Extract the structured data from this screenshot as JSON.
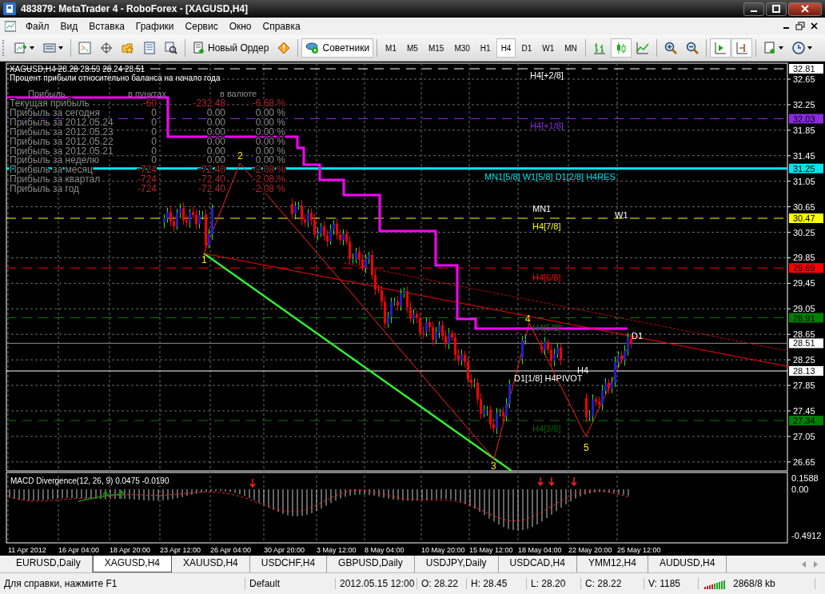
{
  "window": {
    "title": "483879: MetaTrader 4 - RoboForex - [XAGUSD,H4]"
  },
  "menu": [
    "Файл",
    "Вид",
    "Вставка",
    "Графики",
    "Сервис",
    "Окно",
    "Справка"
  ],
  "toolbar": {
    "new_order": "Новый Ордер",
    "expert_advisors": {
      "label": "Советники",
      "pressed": true
    },
    "timeframes": [
      {
        "label": "M1",
        "selected": false
      },
      {
        "label": "M5",
        "selected": false
      },
      {
        "label": "M15",
        "selected": false
      },
      {
        "label": "M30",
        "selected": false
      },
      {
        "label": "H1",
        "selected": false
      },
      {
        "label": "H4",
        "selected": true
      },
      {
        "label": "D1",
        "selected": false
      },
      {
        "label": "W1",
        "selected": false
      },
      {
        "label": "MN",
        "selected": false
      }
    ],
    "chart_types": [
      {
        "kind": "bars",
        "selected": false
      },
      {
        "kind": "candles",
        "selected": true
      },
      {
        "kind": "line",
        "selected": false
      }
    ],
    "auto_scroll": true,
    "chart_shift": true
  },
  "chart": {
    "header": "XAGUSD,H4 28.28 28.59 28.24 28.51",
    "subtitle": "Процент прибыли относительно баланса на начало года",
    "profit_table": {
      "columns": [
        "Прибыль",
        "в пунктах",
        "в валюте"
      ],
      "rows": [
        {
          "label": "Текущая прибыль",
          "points": "-60",
          "currency": "-232.48",
          "percent": "-6.68 %",
          "color": "#b02828"
        },
        {
          "label": "Прибыль за сегодня",
          "points": "0",
          "currency": "0.00",
          "percent": "0.00 %",
          "color": "#8c8c8c"
        },
        {
          "label": "Прибыль за 2012.05.24",
          "points": "0",
          "currency": "0.00",
          "percent": "0.00 %",
          "color": "#8c8c8c"
        },
        {
          "label": "Прибыль за 2012.05.23",
          "points": "0",
          "currency": "0.00",
          "percent": "0.00 %",
          "color": "#8c8c8c"
        },
        {
          "label": "Прибыль за 2012.05.22",
          "points": "0",
          "currency": "0.00",
          "percent": "0.00 %",
          "color": "#8c8c8c"
        },
        {
          "label": "Прибыль за 2012.05.21",
          "points": "0",
          "currency": "0.00",
          "percent": "0.00 %",
          "color": "#8c8c8c"
        },
        {
          "label": "Прибыль за неделю",
          "points": "0",
          "currency": "0.00",
          "percent": "0.00 %",
          "color": "#8c8c8c"
        },
        {
          "label": "Прибыль за месяц",
          "points": "-724",
          "currency": "-72.40",
          "percent": "-2.08 %",
          "color": "#b02828"
        },
        {
          "label": "Прибыль за квартал",
          "points": "-724",
          "currency": "-72.40",
          "percent": "-2.08 %",
          "color": "#b02828"
        },
        {
          "label": "Прибыль за год",
          "points": "-724",
          "currency": "-72.40",
          "percent": "-2.08 %",
          "color": "#b02828"
        }
      ]
    },
    "levels": [
      {
        "label": "H4[+2/8]",
        "color": "#ffffff"
      },
      {
        "label": "H4[+1/8]",
        "color": "#8a2be2"
      },
      {
        "label": "MN1[5/8] W1[5/8] D1[2/8] H4RES",
        "color": "#00e5ee"
      },
      {
        "label": "MN1",
        "color": "#ffffff"
      },
      {
        "label": "W1",
        "color": "#ffffff"
      },
      {
        "label": "H4[7/8]",
        "color": "#ffff00"
      },
      {
        "label": "H4[6/8]",
        "color": "#ff0000"
      },
      {
        "label": "H4[5/8]",
        "color": "#008000"
      },
      {
        "label": "D1[1/8] H4PIVOT",
        "color": "#ffffff"
      },
      {
        "label": "H4",
        "color": "#ffffff"
      },
      {
        "label": "D1",
        "color": "#ffffff"
      },
      {
        "label": "H4[3/8]",
        "color": "#006400"
      }
    ],
    "waves": [
      "1",
      "2",
      "3",
      "4",
      "5"
    ],
    "price_ticks": [
      "32.65",
      "32.25",
      "31.85",
      "31.45",
      "31.05",
      "30.65",
      "30.25",
      "29.85",
      "29.45",
      "29.05",
      "28.65",
      "28.25",
      "27.85",
      "27.45",
      "27.05",
      "26.65"
    ],
    "price_tags": [
      {
        "value": "32.81",
        "color": "#ffffff"
      },
      {
        "value": "32.03",
        "color": "#8a2be2"
      },
      {
        "value": "31.25",
        "color": "#00e5ee"
      },
      {
        "value": "30.47",
        "color": "#ffff00"
      },
      {
        "value": "29.69",
        "color": "#ff0000"
      },
      {
        "value": "28.91",
        "color": "#008000"
      },
      {
        "value": "28.51",
        "color": "#ffffff"
      },
      {
        "value": "28.13",
        "color": "#ffffff"
      },
      {
        "value": "27.34",
        "color": "#008000"
      }
    ],
    "time_labels": [
      "11 Apr 2012",
      "16 Apr 04:00",
      "18 Apr 20:00",
      "23 Apr 12:00",
      "26 Apr 04:00",
      "30 Apr 20:00",
      "3 May 12:00",
      "8 May 04:00",
      "10 May 20:00",
      "15 May 12:00",
      "18 May 04:00",
      "22 May 20:00",
      "25 May 12:00"
    ]
  },
  "macd": {
    "title": "MACD Divergence(12, 26, 9) 0.0475 -0.0190",
    "ticks": [
      "0.1588",
      "0.00",
      "-0.4912"
    ]
  },
  "tabs": [
    {
      "label": "EURUSD,Daily",
      "selected": false
    },
    {
      "label": "XAGUSD,H4",
      "selected": true
    },
    {
      "label": "XAUUSD,H4",
      "selected": false
    },
    {
      "label": "USDCHF,H4",
      "selected": false
    },
    {
      "label": "GBPUSD,Daily",
      "selected": false
    },
    {
      "label": "USDJPY,Daily",
      "selected": false
    },
    {
      "label": "USDCAD,H4",
      "selected": false
    },
    {
      "label": "YMM12,H4",
      "selected": false
    },
    {
      "label": "AUDUSD,H4",
      "selected": false
    }
  ],
  "status_bar": [
    "Для справки, нажмите F1",
    "Default",
    "2012.05.15 12:00",
    "O: 28.22",
    "H: 28.45",
    "L: 28.20",
    "C: 28.22",
    "V: 1185",
    "2868/8 kb"
  ]
}
